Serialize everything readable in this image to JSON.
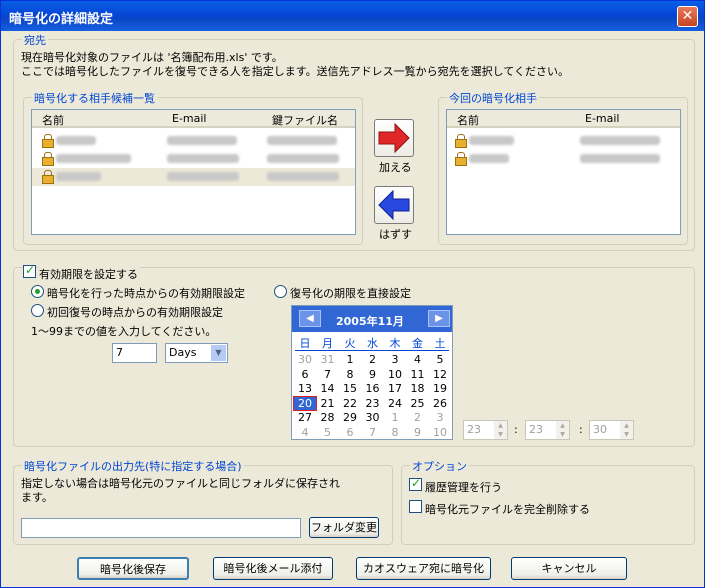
{
  "window": {
    "title": "暗号化の詳細設定",
    "close": "✕"
  },
  "destination": {
    "legend": "宛先",
    "desc1": "現在暗号化対象のファイルは '名簿配布用.xls' です。",
    "desc2": "ここでは暗号化したファイルを復号できる人を指定します。送信先アドレス一覧から宛先を選択してください。"
  },
  "candidates": {
    "legend": "暗号化する相手候補一覧",
    "columns": [
      "名前",
      "E-mail",
      "鍵ファイル名"
    ]
  },
  "current": {
    "legend": "今回の暗号化相手",
    "columns": [
      "名前",
      "E-mail"
    ]
  },
  "buttons": {
    "add": "加える",
    "remove": "はずす",
    "save": "暗号化後保存",
    "mail": "暗号化後メール添付",
    "kao": "カオスウェア宛に暗号化",
    "cancel": "キャンセル",
    "folder": "フォルダ変更"
  },
  "expiry": {
    "enable": "有効期限を設定する",
    "opt_encrypt": "暗号化を行った時点からの有効期限設定",
    "opt_first": "初回復号の時点からの有効期限設定",
    "opt_direct": "復号化の期限を直接設定",
    "hint": "1〜99までの値を入力してください。",
    "value": "7",
    "unit": "Days"
  },
  "calendar": {
    "month": "2005年11月",
    "weekdays": [
      "日",
      "月",
      "火",
      "水",
      "木",
      "金",
      "土"
    ],
    "weeks": [
      [
        "30",
        "31",
        "1",
        "2",
        "3",
        "4",
        "5"
      ],
      [
        "6",
        "7",
        "8",
        "9",
        "10",
        "11",
        "12"
      ],
      [
        "13",
        "14",
        "15",
        "16",
        "17",
        "18",
        "19"
      ],
      [
        "20",
        "21",
        "22",
        "23",
        "24",
        "25",
        "26"
      ],
      [
        "27",
        "28",
        "29",
        "30",
        "1",
        "2",
        "3"
      ],
      [
        "4",
        "5",
        "6",
        "7",
        "8",
        "9",
        "10"
      ]
    ],
    "selected": "20"
  },
  "time": {
    "hour": "23",
    "minute": "23",
    "second": "30",
    "sep": ":"
  },
  "output": {
    "legend": "暗号化ファイルの出力先(特に指定する場合)",
    "desc": "指定しない場合は暗号化元のファイルと同じフォルダに保存されます。",
    "path": ""
  },
  "options": {
    "legend": "オプション",
    "history": "履歴管理を行う",
    "delete": "暗号化元ファイルを完全削除する"
  },
  "colors": {
    "accent": "#0046D5",
    "titlebar": "#0A5FE6",
    "cal_header": "#3167D5"
  }
}
